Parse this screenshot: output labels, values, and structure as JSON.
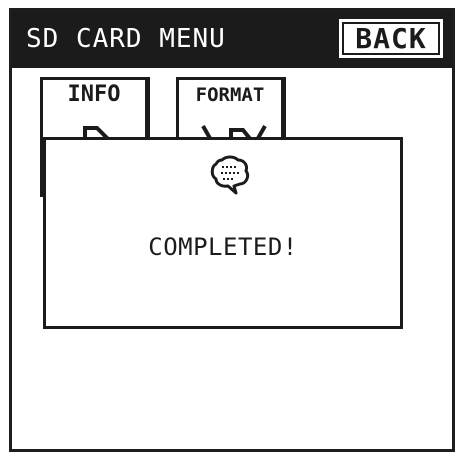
{
  "header": {
    "title": "SD CARD MENU",
    "back_label": "BACK"
  },
  "menu": {
    "items": [
      {
        "label": "INFO",
        "icon": "sd-card-info-icon"
      },
      {
        "label": "FORMAT",
        "icon": "sd-card-format-icon"
      }
    ]
  },
  "dialog": {
    "icon": "speech-bubble-icon",
    "message": "COMPLETED!"
  },
  "colors": {
    "header_background": "#1b1b1b",
    "header_text": "#ffffff",
    "foreground": "#1b1b1b",
    "background": "#ffffff"
  }
}
